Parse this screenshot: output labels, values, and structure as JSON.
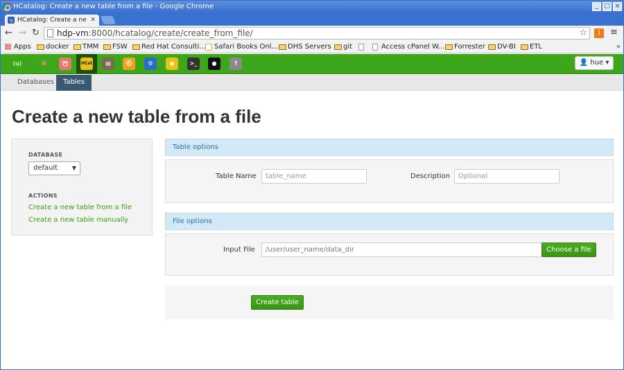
{
  "window": {
    "title": "HCatalog: Create a new table from a file - Google Chrome",
    "tab_title": "HCatalog: Create a ne"
  },
  "browser": {
    "url_host": "hdp-vm",
    "url_rest": ":8000/hcatalog/create/create_from_file/",
    "bookmarks": [
      {
        "label": "Apps",
        "icon": "apps-icon"
      },
      {
        "label": "docker",
        "icon": "folder-icon"
      },
      {
        "label": "TMM",
        "icon": "folder-icon"
      },
      {
        "label": "FSW",
        "icon": "folder-icon"
      },
      {
        "label": "Red Hat Consulti...",
        "icon": "folder-icon"
      },
      {
        "label": "Safari Books Onl...",
        "icon": "safari-icon"
      },
      {
        "label": "DHS Servers",
        "icon": "folder-icon"
      },
      {
        "label": "git",
        "icon": "folder-icon"
      },
      {
        "label": "",
        "icon": "page-icon"
      },
      {
        "label": "Access cPanel W...",
        "icon": "page-icon"
      },
      {
        "label": "Forrester",
        "icon": "folder-icon"
      },
      {
        "label": "DV-BI",
        "icon": "folder-icon"
      },
      {
        "label": "ETL",
        "icon": "folder-icon"
      }
    ],
    "more": "»"
  },
  "navbar": {
    "apps": [
      {
        "name": "hue-logo-icon",
        "glyph": "(ɥ)",
        "color": "#2e8a12"
      },
      {
        "name": "hive-icon",
        "glyph": "🐝",
        "color": "#3ea61a"
      },
      {
        "name": "pig-icon",
        "glyph": "🐷",
        "color": "#e6786f"
      },
      {
        "name": "hcatalog-icon",
        "glyph": "HCat",
        "color": "#2a2a2a"
      },
      {
        "name": "file-browser-icon",
        "glyph": "▤",
        "color": "#7a6a4f"
      },
      {
        "name": "job-browser-icon",
        "glyph": "⛑",
        "color": "#f0a020"
      },
      {
        "name": "job-designer-icon",
        "glyph": "⚙",
        "color": "#2b6cc4"
      },
      {
        "name": "oozie-icon",
        "glyph": "◉",
        "color": "#e6c219"
      },
      {
        "name": "shell-icon",
        "glyph": ">_",
        "color": "#333333"
      },
      {
        "name": "user-admin-icon",
        "glyph": "●",
        "color": "#111111"
      },
      {
        "name": "help-icon",
        "glyph": "?",
        "color": "#8a8a8a"
      }
    ],
    "user_label": "hue"
  },
  "subnav": {
    "tabs": [
      {
        "label": "Databases",
        "active": false
      },
      {
        "label": "Tables",
        "active": true
      }
    ]
  },
  "page": {
    "title": "Create a new table from a file"
  },
  "sidebar": {
    "database_header": "DATABASE",
    "database_value": "default",
    "actions_header": "ACTIONS",
    "actions": [
      "Create a new table from a file",
      "Create a new table manually"
    ]
  },
  "table_options": {
    "heading": "Table options",
    "name_label": "Table Name",
    "name_placeholder": "table_name",
    "description_label": "Description",
    "description_placeholder": "Optional"
  },
  "file_options": {
    "heading": "File options",
    "input_label": "Input File",
    "input_value": "/user/user_name/data_dir",
    "choose_button": "Choose a file"
  },
  "submit_button": "Create table",
  "colors": {
    "accent_green": "#3ea61a",
    "link_green": "#3a9d12",
    "header_blue": "#d3e9f5",
    "active_tab": "#3b5873"
  }
}
